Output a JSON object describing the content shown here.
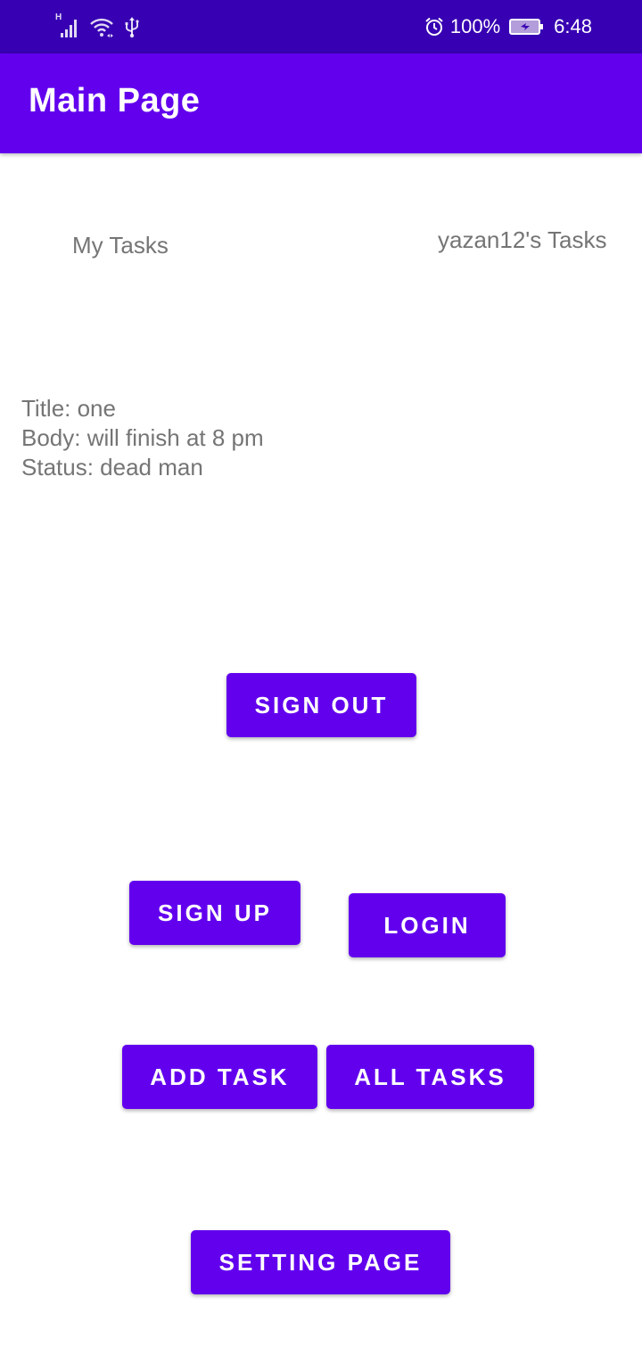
{
  "status_bar": {
    "network_type": "H",
    "battery_percent": "100%",
    "time": "6:48",
    "icons": [
      "signal-icon",
      "wifi-icon",
      "usb-icon",
      "alarm-icon",
      "battery-charging-icon"
    ],
    "colors": {
      "background": "#3700b3",
      "foreground": "#ffffff"
    }
  },
  "app_bar": {
    "title": "Main Page",
    "color": "#6200ee"
  },
  "labels": {
    "my_tasks": "My Tasks",
    "user_tasks": "yazan12's Tasks"
  },
  "task": {
    "title_line": "Title: one",
    "body_line": "Body: will finish at 8 pm",
    "status_line": "Status: dead man"
  },
  "buttons": {
    "sign_out": "SIGN OUT",
    "sign_up": "SIGN UP",
    "login": "LOGIN",
    "add_task": "ADD TASK",
    "all_tasks": "ALL TASKS",
    "setting_page": "SETTING PAGE"
  },
  "colors": {
    "accent": "#6200ee",
    "text_secondary": "#757575",
    "background": "#ffffff"
  }
}
